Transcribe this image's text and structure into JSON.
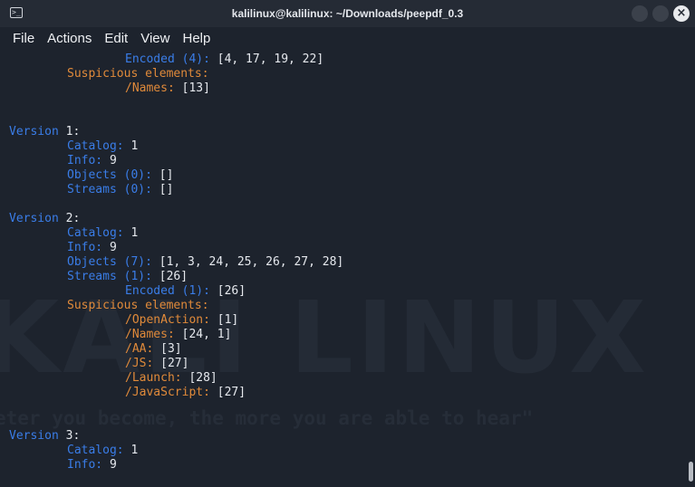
{
  "window": {
    "title": "kalilinux@kalilinux: ~/Downloads/peepdf_0.3"
  },
  "menu": [
    "File",
    "Actions",
    "Edit",
    "View",
    "Help"
  ],
  "watermark": {
    "logo": "KALI LINUX",
    "slogan": "eter you become, the more you are able to hear\""
  },
  "terminal": {
    "lines": [
      {
        "k": "Encoded (4):",
        "v": " [4, 17, 19, 22]",
        "indent": 2,
        "kc": "blue"
      },
      {
        "k": "Suspicious elements:",
        "v": "",
        "indent": 1,
        "kc": "orange"
      },
      {
        "k": "/Names:",
        "v": " [13]",
        "indent": 2,
        "kc": "orange"
      },
      {
        "k": "",
        "v": "",
        "indent": 0,
        "kc": "blue"
      },
      {
        "k": "",
        "v": "",
        "indent": 0,
        "kc": "blue"
      },
      {
        "k": "Version",
        "v": " 1:",
        "indent": 0,
        "kc": "blue"
      },
      {
        "k": "Catalog:",
        "v": " 1",
        "indent": 1,
        "kc": "blue"
      },
      {
        "k": "Info:",
        "v": " 9",
        "indent": 1,
        "kc": "blue"
      },
      {
        "k": "Objects (0):",
        "v": " []",
        "indent": 1,
        "kc": "blue"
      },
      {
        "k": "Streams (0):",
        "v": " []",
        "indent": 1,
        "kc": "blue"
      },
      {
        "k": "",
        "v": "",
        "indent": 0,
        "kc": "blue"
      },
      {
        "k": "Version",
        "v": " 2:",
        "indent": 0,
        "kc": "blue"
      },
      {
        "k": "Catalog:",
        "v": " 1",
        "indent": 1,
        "kc": "blue"
      },
      {
        "k": "Info:",
        "v": " 9",
        "indent": 1,
        "kc": "blue"
      },
      {
        "k": "Objects (7):",
        "v": " [1, 3, 24, 25, 26, 27, 28]",
        "indent": 1,
        "kc": "blue"
      },
      {
        "k": "Streams (1):",
        "v": " [26]",
        "indent": 1,
        "kc": "blue"
      },
      {
        "k": "Encoded (1):",
        "v": " [26]",
        "indent": 2,
        "kc": "blue"
      },
      {
        "k": "Suspicious elements:",
        "v": "",
        "indent": 1,
        "kc": "orange"
      },
      {
        "k": "/OpenAction:",
        "v": " [1]",
        "indent": 2,
        "kc": "orange"
      },
      {
        "k": "/Names:",
        "v": " [24, 1]",
        "indent": 2,
        "kc": "orange"
      },
      {
        "k": "/AA:",
        "v": " [3]",
        "indent": 2,
        "kc": "orange"
      },
      {
        "k": "/JS:",
        "v": " [27]",
        "indent": 2,
        "kc": "orange"
      },
      {
        "k": "/Launch:",
        "v": " [28]",
        "indent": 2,
        "kc": "orange"
      },
      {
        "k": "/JavaScript:",
        "v": " [27]",
        "indent": 2,
        "kc": "orange"
      },
      {
        "k": "",
        "v": "",
        "indent": 0,
        "kc": "blue"
      },
      {
        "k": "",
        "v": "",
        "indent": 0,
        "kc": "blue"
      },
      {
        "k": "Version",
        "v": " 3:",
        "indent": 0,
        "kc": "blue"
      },
      {
        "k": "Catalog:",
        "v": " 1",
        "indent": 1,
        "kc": "blue"
      },
      {
        "k": "Info:",
        "v": " 9",
        "indent": 1,
        "kc": "blue"
      }
    ]
  },
  "colors": {
    "blue": "#3a7de8",
    "orange": "#e08a3a",
    "value": "#e6e9ee",
    "background": "#1d232d"
  }
}
